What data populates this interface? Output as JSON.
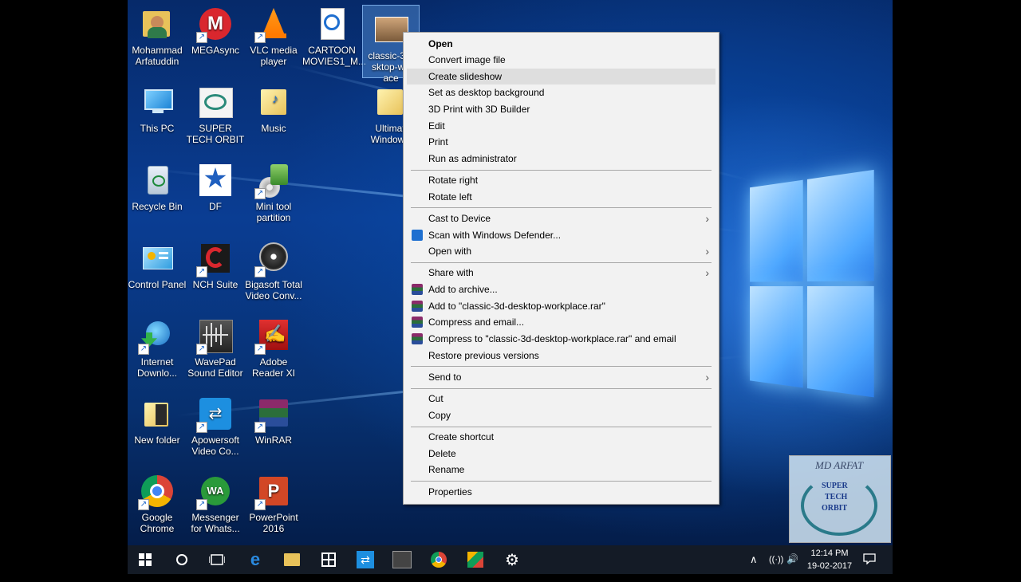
{
  "desktop_icons": [
    {
      "label": "Mohammad Arfatuddin",
      "icon": "user-folder-icon"
    },
    {
      "label": "MEGAsync",
      "icon": "mega-icon"
    },
    {
      "label": "VLC media player",
      "icon": "vlc-icon"
    },
    {
      "label": "CARTOON MOVIES1_M...",
      "icon": "media-file-icon"
    },
    {
      "label": "classic-3d-\nsktop-wo\nace",
      "icon": "image-file-icon"
    },
    {
      "label": "This PC",
      "icon": "computer-icon"
    },
    {
      "label": "SUPER TECH ORBIT",
      "icon": "image-icon"
    },
    {
      "label": "Music",
      "icon": "music-folder-icon"
    },
    {
      "label": "Ultimat Windows",
      "icon": "folder-icon"
    },
    {
      "label": "Recycle Bin",
      "icon": "recycle-bin-icon"
    },
    {
      "label": "DF",
      "icon": "star-logo-icon"
    },
    {
      "label": "Mini tool partition",
      "icon": "disk-icon"
    },
    {
      "label": "Control Panel",
      "icon": "control-panel-icon"
    },
    {
      "label": "NCH Suite",
      "icon": "nch-icon"
    },
    {
      "label": "Bigasoft Total Video Conv...",
      "icon": "film-reel-icon"
    },
    {
      "label": "Internet Downlo...",
      "icon": "idm-icon"
    },
    {
      "label": "WavePad Sound Editor",
      "icon": "waveform-icon"
    },
    {
      "label": "Adobe Reader XI",
      "icon": "pdf-icon"
    },
    {
      "label": "New folder",
      "icon": "folder-icon"
    },
    {
      "label": "Apowersoft Video Co...",
      "icon": "apowersoft-icon"
    },
    {
      "label": "WinRAR",
      "icon": "winrar-icon"
    },
    {
      "label": "Google Chrome",
      "icon": "chrome-icon"
    },
    {
      "label": "Messenger for Whats...",
      "icon": "whatsapp-icon"
    },
    {
      "label": "PowerPoint 2016",
      "icon": "powerpoint-icon"
    }
  ],
  "context_menu": {
    "open": "Open",
    "convert": "Convert image file",
    "slideshow": "Create slideshow",
    "desktop_bg": "Set as desktop background",
    "print3d": "3D Print with 3D Builder",
    "edit": "Edit",
    "print": "Print",
    "run_admin": "Run as administrator",
    "rotate_right": "Rotate right",
    "rotate_left": "Rotate left",
    "cast": "Cast to Device",
    "scan": "Scan with Windows Defender...",
    "open_with": "Open with",
    "share_with": "Share with",
    "add_archive": "Add to archive...",
    "add_rar": "Add to \"classic-3d-desktop-workplace.rar\"",
    "compress_email": "Compress and email...",
    "compress_rar_email": "Compress to \"classic-3d-desktop-workplace.rar\" and email",
    "restore": "Restore previous versions",
    "send_to": "Send to",
    "cut": "Cut",
    "copy": "Copy",
    "create_shortcut": "Create shortcut",
    "delete": "Delete",
    "rename": "Rename",
    "properties": "Properties",
    "arrow": "›"
  },
  "taskbar": {
    "start": "⊞",
    "search": "○",
    "task_view": "▭",
    "time": "12:14 PM",
    "date": "19-02-2017",
    "tray_up": "∧",
    "wifi": "((·))",
    "volume": "🔊",
    "notify": "▭"
  },
  "watermark": {
    "line1": "MD ARFAT",
    "line2": "SUPER",
    "line3": "TECH",
    "line4": "ORBIT"
  },
  "colors": {
    "menu_bg": "#f2f2f2",
    "menu_highlight": "#dedede",
    "taskbar_bg": "#141b26",
    "desktop_blue": "#0a3d93"
  }
}
